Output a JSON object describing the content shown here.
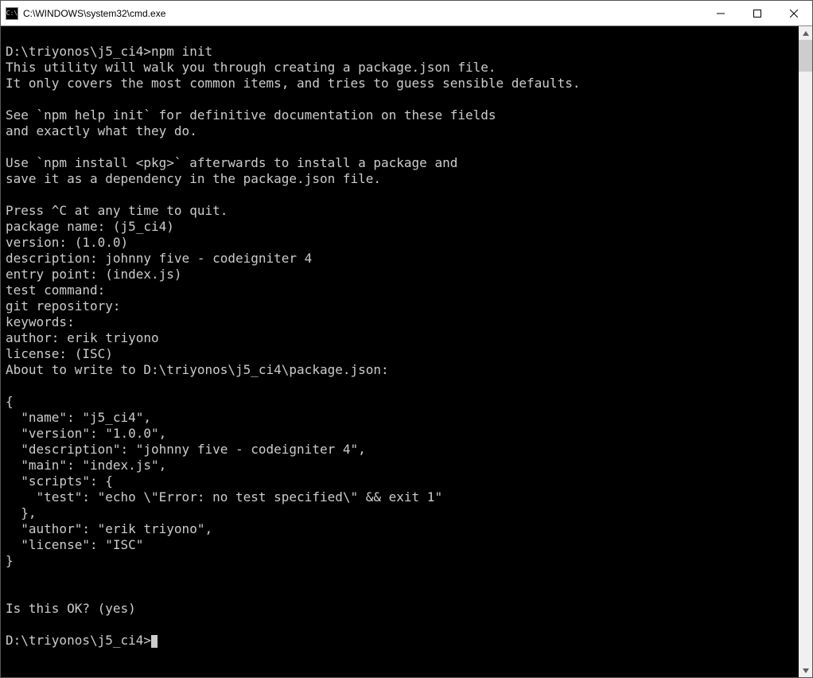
{
  "window": {
    "title": "C:\\WINDOWS\\system32\\cmd.exe",
    "icon_label": "C:\\"
  },
  "terminal": {
    "lines": [
      "",
      "D:\\triyonos\\j5_ci4>npm init",
      "This utility will walk you through creating a package.json file.",
      "It only covers the most common items, and tries to guess sensible defaults.",
      "",
      "See `npm help init` for definitive documentation on these fields",
      "and exactly what they do.",
      "",
      "Use `npm install <pkg>` afterwards to install a package and",
      "save it as a dependency in the package.json file.",
      "",
      "Press ^C at any time to quit.",
      "package name: (j5_ci4)",
      "version: (1.0.0)",
      "description: johnny five - codeigniter 4",
      "entry point: (index.js)",
      "test command:",
      "git repository:",
      "keywords:",
      "author: erik triyono",
      "license: (ISC)",
      "About to write to D:\\triyonos\\j5_ci4\\package.json:",
      "",
      "{",
      "  \"name\": \"j5_ci4\",",
      "  \"version\": \"1.0.0\",",
      "  \"description\": \"johnny five - codeigniter 4\",",
      "  \"main\": \"index.js\",",
      "  \"scripts\": {",
      "    \"test\": \"echo \\\"Error: no test specified\\\" && exit 1\"",
      "  },",
      "  \"author\": \"erik triyono\",",
      "  \"license\": \"ISC\"",
      "}",
      "",
      "",
      "Is this OK? (yes)",
      "",
      "D:\\triyonos\\j5_ci4>"
    ]
  }
}
